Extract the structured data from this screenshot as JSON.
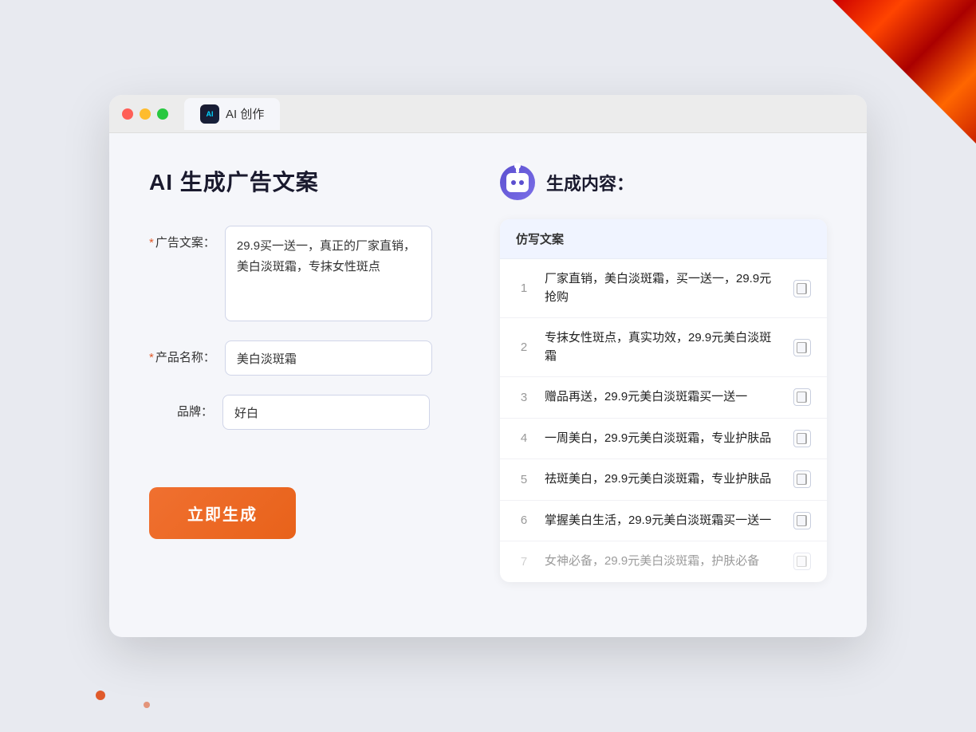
{
  "decorative": {
    "corner": "top-right red triangle"
  },
  "browser": {
    "tab_label": "AI 创作",
    "ai_icon_alt": "AI logo"
  },
  "left": {
    "page_title": "AI 生成广告文案",
    "ad_copy_label": "广告文案：",
    "ad_copy_required": "*",
    "ad_copy_value": "29.9买一送一，真正的厂家直销，美白淡斑霜，专抹女性斑点",
    "product_name_label": "产品名称：",
    "product_name_required": "*",
    "product_name_value": "美白淡斑霜",
    "brand_label": "品牌：",
    "brand_value": "好白",
    "generate_button": "立即生成"
  },
  "right": {
    "section_title": "生成内容：",
    "table_header": "仿写文案",
    "results": [
      {
        "num": "1",
        "text": "厂家直销，美白淡斑霜，买一送一，29.9元抢购"
      },
      {
        "num": "2",
        "text": "专抹女性斑点，真实功效，29.9元美白淡斑霜"
      },
      {
        "num": "3",
        "text": "赠品再送，29.9元美白淡斑霜买一送一"
      },
      {
        "num": "4",
        "text": "一周美白，29.9元美白淡斑霜，专业护肤品"
      },
      {
        "num": "5",
        "text": "祛斑美白，29.9元美白淡斑霜，专业护肤品"
      },
      {
        "num": "6",
        "text": "掌握美白生活，29.9元美白淡斑霜买一送一"
      },
      {
        "num": "7",
        "text": "女神必备，29.9元美白淡斑霜，护肤必备",
        "dim": true
      }
    ]
  }
}
